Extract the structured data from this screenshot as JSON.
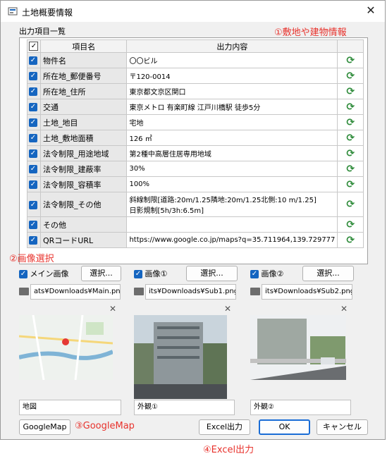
{
  "window": {
    "title": "土地概要情報",
    "close_glyph": "✕"
  },
  "output_section_label": "出力項目一覧",
  "annotations": {
    "a1": "①敷地や建物情報",
    "a2": "②画像選択",
    "a3": "③GoogleMap",
    "a4": "④Excel出力"
  },
  "table": {
    "headers": {
      "name": "項目名",
      "value": "出力内容"
    },
    "rows": [
      {
        "name": "物件名",
        "value": "〇〇ビル"
      },
      {
        "name": "所在地_郵便番号",
        "value": "〒120-0014"
      },
      {
        "name": "所在地_住所",
        "value": "東京都文京区関口"
      },
      {
        "name": "交通",
        "value": "東京メトロ 有楽町線 江戸川橋駅 徒歩5分"
      },
      {
        "name": "土地_地目",
        "value": "宅地"
      },
      {
        "name": "土地_敷地面積",
        "value": "126 ㎡"
      },
      {
        "name": "法令制限_用途地域",
        "value": "第2種中高層住居専用地域"
      },
      {
        "name": "法令制限_建蔽率",
        "value": "30%"
      },
      {
        "name": "法令制限_容積率",
        "value": "100%"
      },
      {
        "name": "法令制限_その他",
        "value": "斜線制限[道路:20m/1.25隣地:20m/1.25北側:10 m/1.25]",
        "value2": "日影規制[5h/3h:6.5m]"
      },
      {
        "name": "その他",
        "value": ""
      },
      {
        "name": "QRコードURL",
        "value": "https://www.google.co.jp/maps?q=35.711964,139.729777"
      }
    ]
  },
  "images": [
    {
      "check_label": "メイン画像",
      "select_label": "選択...",
      "path": "ats¥Downloads¥Main.png",
      "caption": "地図",
      "kind": "map"
    },
    {
      "check_label": "画像①",
      "select_label": "選択...",
      "path": "its¥Downloads¥Sub1.png",
      "caption": "外観①",
      "kind": "building"
    },
    {
      "check_label": "画像②",
      "select_label": "選択...",
      "path": "its¥Downloads¥Sub2.png",
      "caption": "外観②",
      "kind": "street"
    }
  ],
  "buttons": {
    "googlemap": "GoogleMap",
    "excel": "Excel出力",
    "ok": "OK",
    "cancel": "キャンセル"
  },
  "colors": {
    "accent": "#1565c0",
    "annotation": "#e8322c",
    "refresh": "#2e8b3a"
  }
}
